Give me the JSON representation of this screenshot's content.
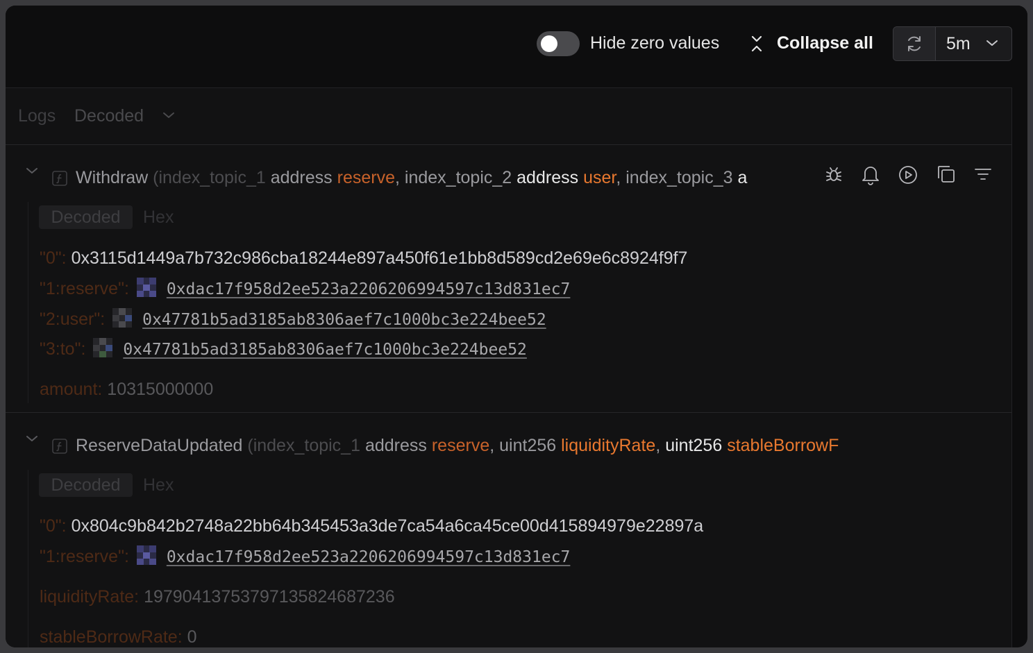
{
  "toolbar": {
    "hide_zero_label": "Hide zero values",
    "collapse_all_label": "Collapse all",
    "interval_value": "5m"
  },
  "panel": {
    "title": "Logs",
    "view_mode": "Decoded"
  },
  "events": [
    {
      "name": "Withdraw",
      "signature": {
        "open": "(index_topic_1",
        "p1_type": "address",
        "p1_name": "reserve",
        "sep1": ",",
        "p2_prefix": "index_topic_2",
        "p2_type": "address",
        "p2_name": "user",
        "sep2": ",",
        "p3_prefix": "index_topic_3",
        "p3_type": "a"
      },
      "tabs": [
        "Decoded",
        "Hex"
      ],
      "rows": [
        {
          "key": "\"0\":",
          "value": "0x3115d1449a7b732c986cba18244e897a450f61e1bb8d589cd2e69e6c8924f9f7"
        },
        {
          "key": "\"1:reserve\":",
          "value": "0xdac17f958d2ee523a2206206994597c13d831ec7"
        },
        {
          "key": "\"2:user\":",
          "value": "0x47781b5ad3185ab8306aef7c1000bc3e224bee52"
        },
        {
          "key": "\"3:to\":",
          "value": "0x47781b5ad3185ab8306aef7c1000bc3e224bee52"
        }
      ],
      "params": [
        {
          "key": "amount:",
          "value": "10315000000"
        }
      ]
    },
    {
      "name": "ReserveDataUpdated",
      "signature": {
        "open": "(index_topic_1",
        "p1_type": "address",
        "p1_name": "reserve",
        "sep1": ",",
        "p2_type": "uint256",
        "p2_name": "liquidityRate",
        "sep2": ",",
        "p3_type": "uint256",
        "p3_name": "stableBorrowF"
      },
      "tabs": [
        "Decoded",
        "Hex"
      ],
      "rows": [
        {
          "key": "\"0\":",
          "value": "0x804c9b842b2748a22bb64b345453a3de7ca54a6ca45ce00d415894979e22897a"
        },
        {
          "key": "\"1:reserve\":",
          "value": "0xdac17f958d2ee523a2206206994597c13d831ec7"
        }
      ],
      "params": [
        {
          "key": "liquidityRate:",
          "value": "19790413753797135824687236"
        },
        {
          "key": "stableBorrowRate:",
          "value": "0"
        }
      ]
    }
  ],
  "icons": [
    "toggle-switch",
    "collapse-icon",
    "refresh-icon",
    "chevron-down-icon",
    "function-icon",
    "bug-icon",
    "bell-icon",
    "play-icon",
    "copy-icon",
    "filter-icon",
    "address-avatar-icon"
  ],
  "colors": {
    "accent": "#e8782f",
    "background": "#0d0d0e"
  }
}
